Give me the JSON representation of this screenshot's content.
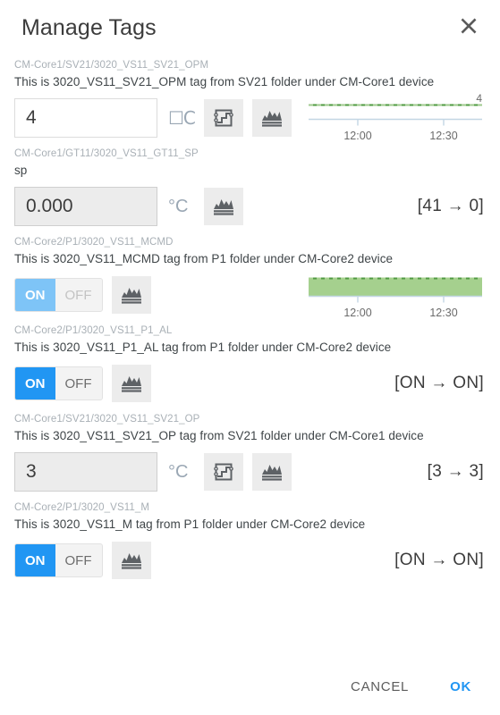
{
  "dialog": {
    "title": "Manage Tags",
    "close_icon": "close-icon"
  },
  "footer": {
    "cancel_label": "CANCEL",
    "ok_label": "OK"
  },
  "colors": {
    "accent_blue": "#2196f3",
    "accent_blue_disabled": "#7ec4f7",
    "trend_green": "#4f9a41",
    "trend_green_fill": "#a5d08e",
    "axis_blue": "#c3d6e4",
    "path_grey": "#a9b0b6",
    "icon_grey": "#5e6266"
  },
  "axis": {
    "tick_labels": [
      "12:00",
      "12:30"
    ]
  },
  "rows": [
    {
      "path": "CM-Core1/SV21/3020_VS11_SV21_OPM",
      "description": "This is 3020_VS11_SV21_OPM tag from SV21 folder under CM-Core1 device",
      "control": "numeric",
      "value": "4",
      "unit": "☐C",
      "unit_missing_glyph": true,
      "input_disabled": false,
      "buttons": [
        "step-editor-icon",
        "trend-chart-icon"
      ],
      "right": "sparkline",
      "sparkline": {
        "style": "line",
        "max_label": "4"
      }
    },
    {
      "path": "CM-Core1/GT11/3020_VS11_GT11_SP",
      "description": "sp",
      "control": "numeric",
      "value": "0.000",
      "unit": "°C",
      "unit_missing_glyph": false,
      "input_disabled": true,
      "buttons": [
        "trend-chart-icon"
      ],
      "right": "status",
      "status": "[41 → 0]"
    },
    {
      "path": "CM-Core2/P1/3020_VS11_MCMD",
      "description": "This is 3020_VS11_MCMD tag from P1 folder under CM-Core2 device",
      "control": "toggle",
      "on_label": "ON",
      "off_label": "OFF",
      "selected": "ON",
      "toggle_disabled": true,
      "buttons": [
        "trend-chart-icon"
      ],
      "right": "sparkline",
      "sparkline": {
        "style": "area",
        "max_label": ""
      }
    },
    {
      "path": "CM-Core2/P1/3020_VS11_P1_AL",
      "description": "This is 3020_VS11_P1_AL tag from P1 folder under CM-Core2 device",
      "control": "toggle",
      "on_label": "ON",
      "off_label": "OFF",
      "selected": "ON",
      "toggle_disabled": false,
      "buttons": [
        "trend-chart-icon"
      ],
      "right": "status",
      "status": "[ON → ON]"
    },
    {
      "path": "CM-Core1/SV21/3020_VS11_SV21_OP",
      "description": "This is 3020_VS11_SV21_OP tag from SV21 folder under CM-Core1 device",
      "control": "numeric",
      "value": "3",
      "unit": "°C",
      "unit_missing_glyph": false,
      "input_disabled": true,
      "buttons": [
        "step-editor-icon",
        "trend-chart-icon"
      ],
      "right": "status",
      "status": "[3 → 3]"
    },
    {
      "path": "CM-Core2/P1/3020_VS11_M",
      "description": "This is 3020_VS11_M tag from P1 folder under CM-Core2 device",
      "control": "toggle",
      "on_label": "ON",
      "off_label": "OFF",
      "selected": "ON",
      "toggle_disabled": false,
      "buttons": [
        "trend-chart-icon"
      ],
      "right": "status",
      "status": "[ON → ON]"
    }
  ]
}
